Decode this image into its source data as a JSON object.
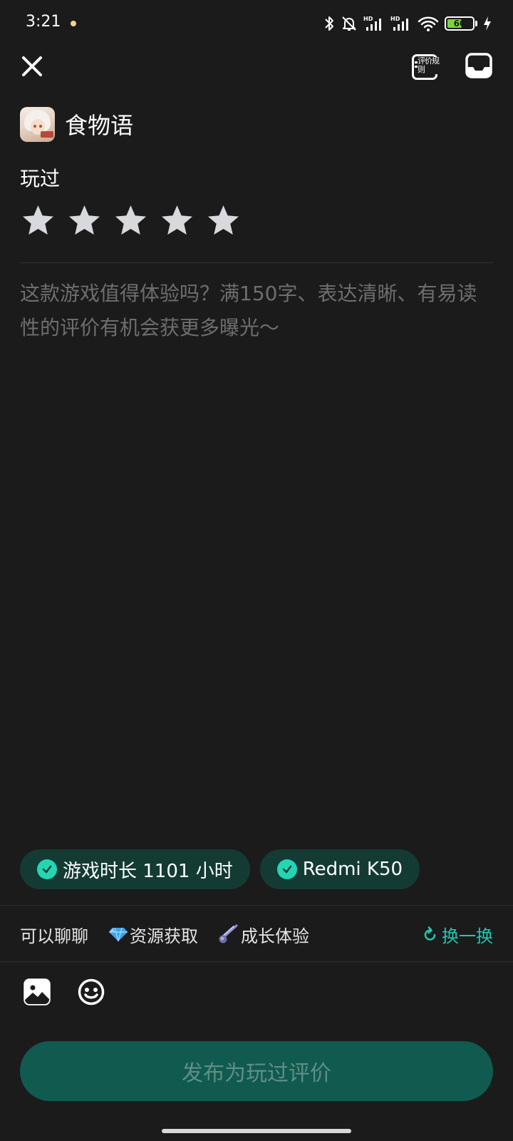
{
  "status_bar": {
    "time": "3:21",
    "battery_level": "60",
    "battery_fraction": 0.6,
    "icons": [
      "bluetooth-icon",
      "notifications-off-icon",
      "hd-signal-icon",
      "hd-signal-icon",
      "wifi-icon",
      "battery-icon",
      "charging-icon"
    ]
  },
  "header": {
    "close_icon": "close-icon",
    "rules_label": "评价规则",
    "rules_icon": "review-rules-icon",
    "draft_icon": "draft-box-icon"
  },
  "game": {
    "name": "食物语",
    "icon": "game-app-icon"
  },
  "rating": {
    "label": "玩过",
    "max_stars": 5,
    "selected_stars": 0
  },
  "review": {
    "value": "",
    "placeholder": "这款游戏值得体验吗？满150字、表达清晰、有易读性的评价有机会获更多曝光～"
  },
  "tags": [
    {
      "label": "游戏时长 1101 小时",
      "icon": "check-circle-icon"
    },
    {
      "label": "Redmi K50",
      "icon": "check-circle-icon"
    }
  ],
  "topics": {
    "items": [
      {
        "label": "可以聊聊",
        "icon": ""
      },
      {
        "label": "资源获取",
        "icon": "gem-icon"
      },
      {
        "label": "成长体验",
        "icon": "comet-icon"
      }
    ],
    "swap_label": "换一换",
    "swap_icon": "refresh-icon"
  },
  "toolbar": {
    "image_icon": "image-icon",
    "emoji_icon": "emoji-icon"
  },
  "publish": {
    "label": "发布为玩过评价"
  },
  "colors": {
    "background": "#1b1b1b",
    "accent": "#23c9b4",
    "tag_background": "#143a34",
    "publish_background": "#105a4f",
    "publish_text": "#5f8f86",
    "placeholder": "#6e6e6e",
    "battery": "#7bd53b"
  }
}
